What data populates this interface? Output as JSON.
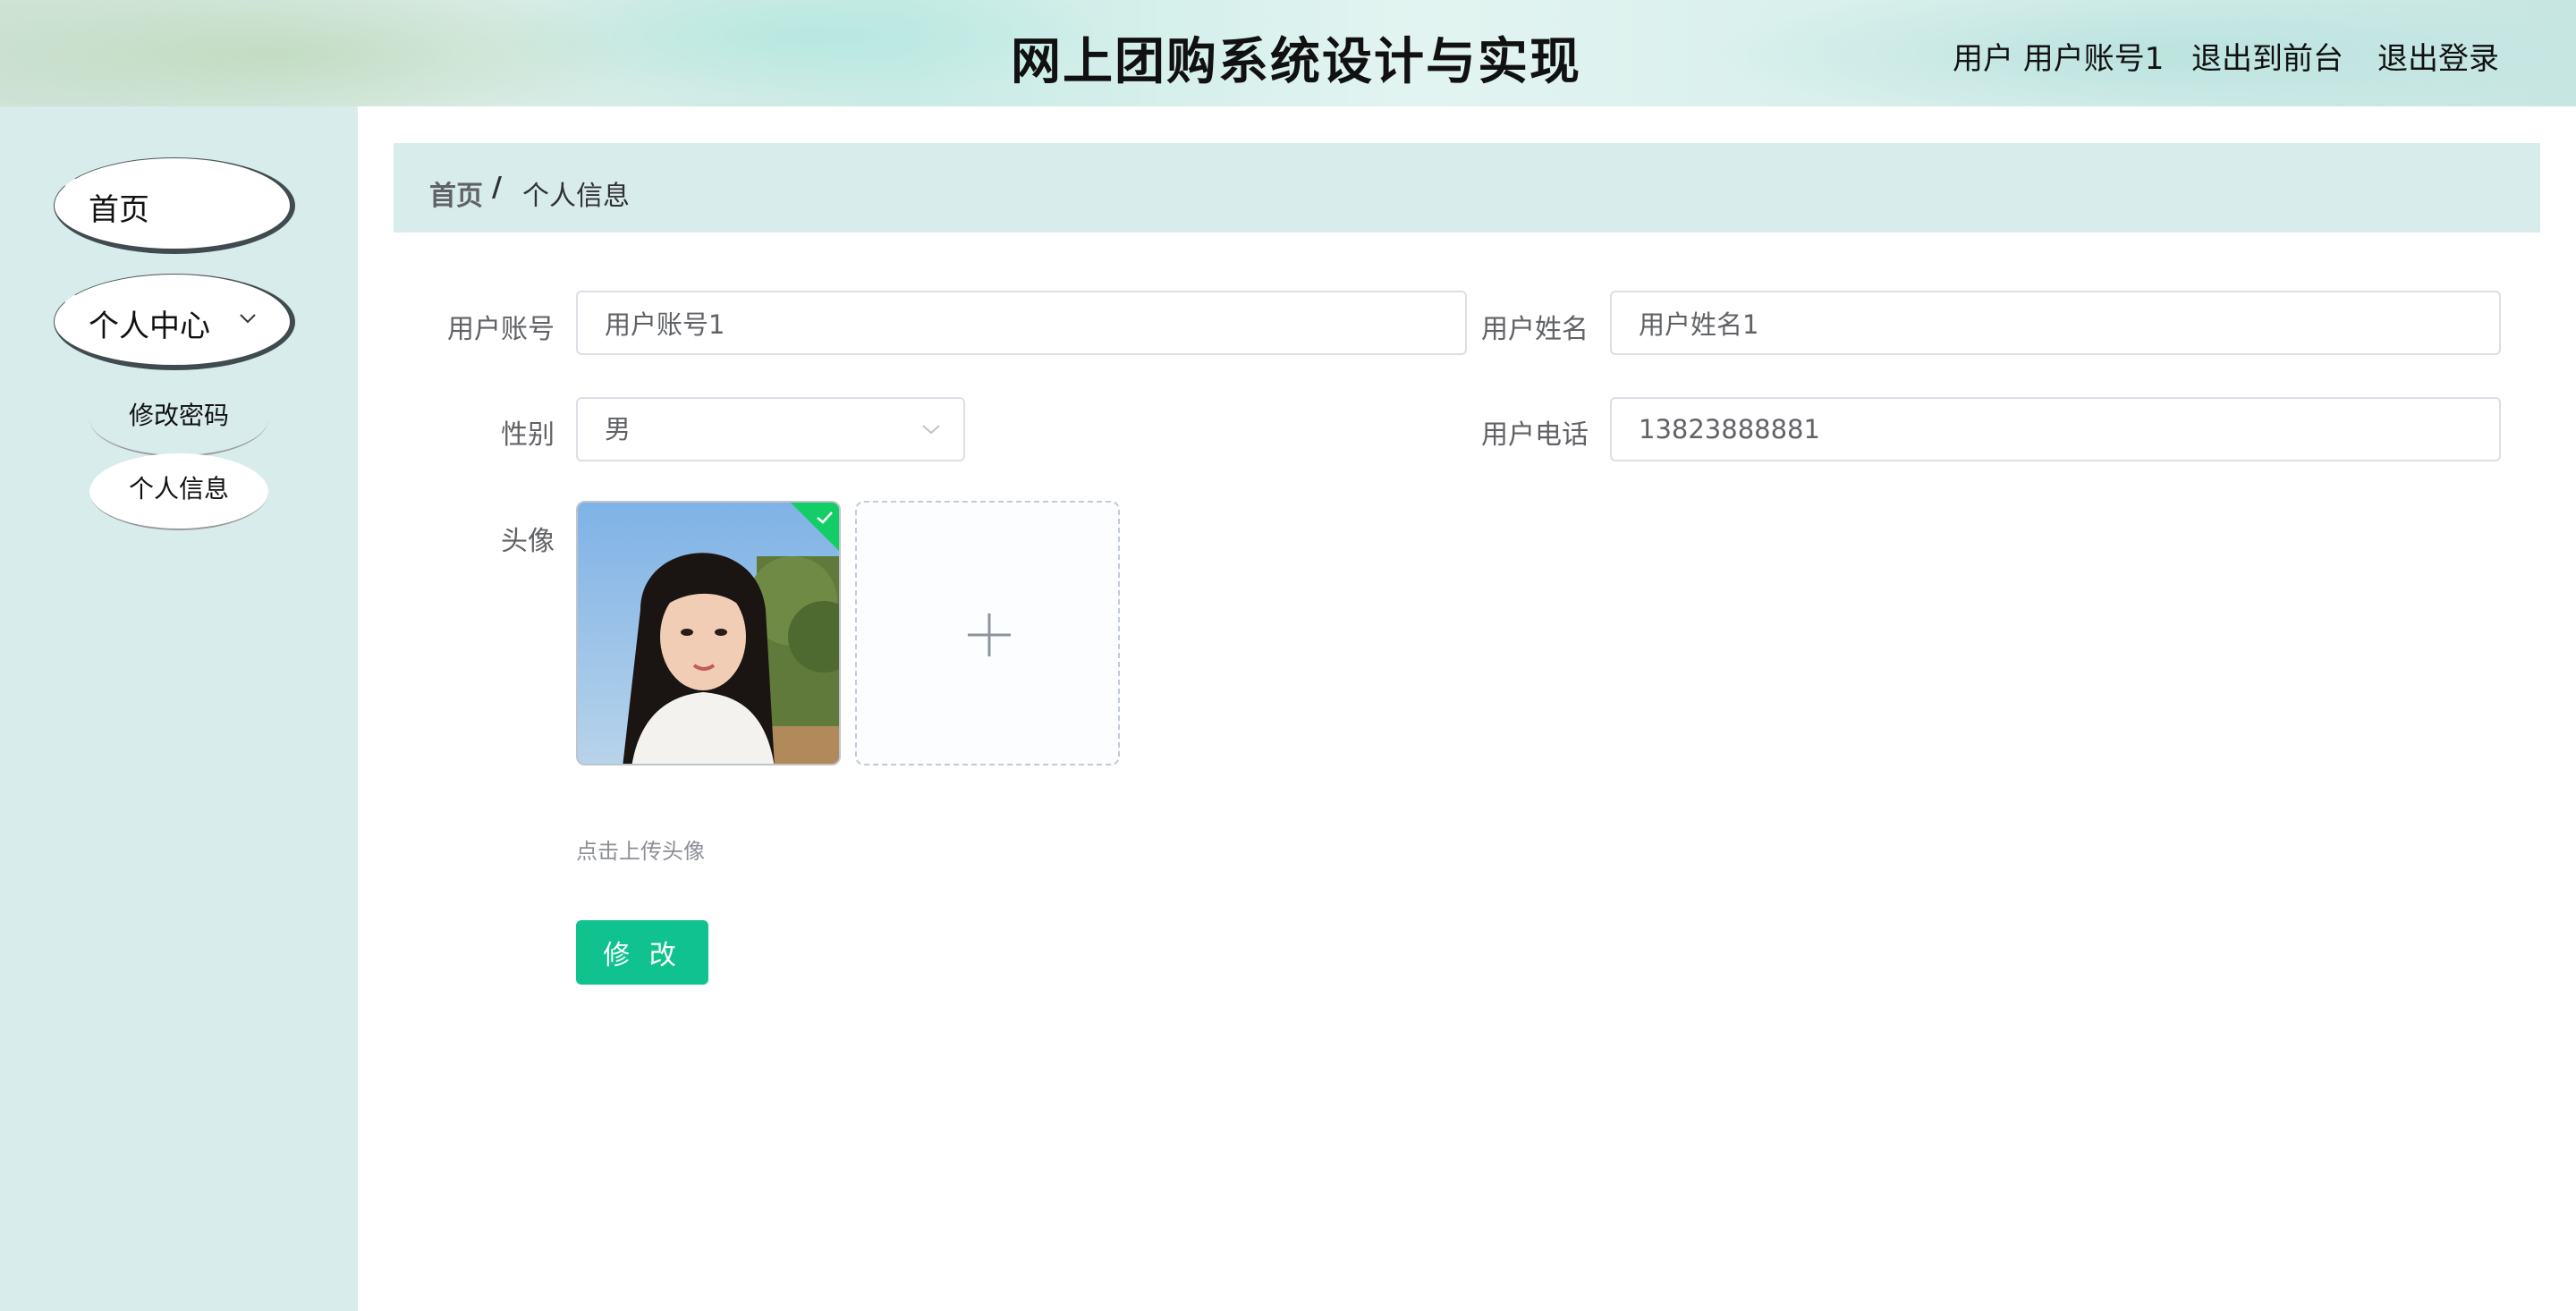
{
  "header": {
    "title": "网上团购系统设计与实现",
    "user_info": "用户 用户账号1",
    "back_to_front": "退出到前台",
    "logout": "退出登录"
  },
  "sidebar": {
    "home": "首页",
    "personal_center": "个人中心",
    "submenu": [
      "修改密码",
      "个人信息"
    ]
  },
  "breadcrumb": {
    "home": "首页",
    "separator": "/",
    "current": "个人信息"
  },
  "form": {
    "account_label": "用户账号",
    "account_value": "用户账号1",
    "name_label": "用户姓名",
    "name_value": "用户姓名1",
    "gender_label": "性别",
    "gender_value": "男",
    "phone_label": "用户电话",
    "phone_value": "13823888881",
    "avatar_label": "头像",
    "upload_tip": "点击上传头像",
    "submit_label": "修 改"
  },
  "colors": {
    "sidebar_bg": "#d8ecec",
    "primary_button": "#10c28e",
    "success_badge": "#13ce66"
  }
}
